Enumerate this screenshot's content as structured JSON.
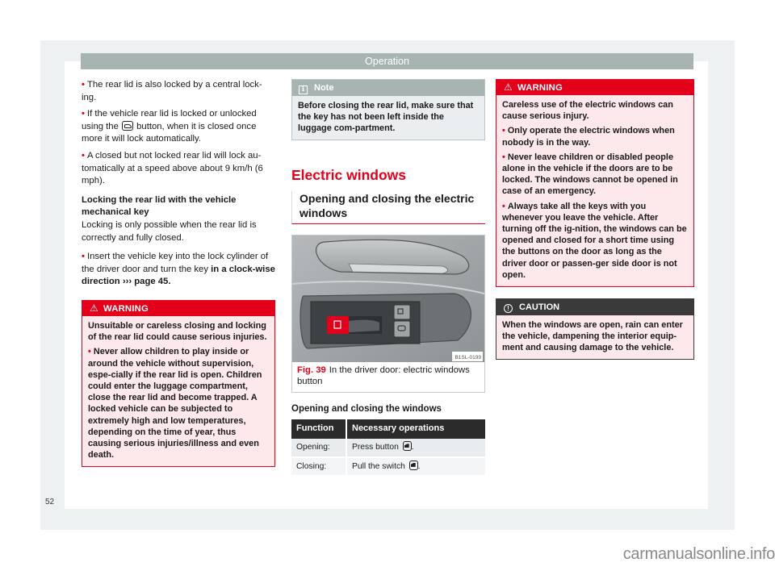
{
  "header": {
    "section": "Operation"
  },
  "page_number": "52",
  "watermark": "carmanualsonline.info",
  "column1": {
    "bullets": [
      "The rear lid is also locked by a central lock-ing.",
      {
        "before": "If the vehicle rear lid is locked or unlocked using the",
        "icon": "rear-lid-key-icon",
        "after": "button, when it is closed once more it will lock automatically."
      },
      "A closed but not locked rear lid will lock au-tomatically at a speed above about 9 km/h (6 mph)."
    ],
    "b1": "The rear lid is also locked by a central lock-ing.",
    "b2_before": "If the vehicle rear lid is locked or unlocked using the",
    "b2_after": "button, when it is closed once more it will lock automatically.",
    "b3": "A closed but not locked rear lid will lock au-tomatically at a speed above about 9 km/h (6 mph).",
    "subheading": "Locking the rear lid with the vehicle mechanical key",
    "paragraph": "Locking is only possible when the rear lid is correctly and fully closed.",
    "b4_before": "Insert the vehicle key into the lock cylinder of the driver door and turn the key",
    "b4_bold": "in a clock-wise direction",
    "b4_link": "››› page 45",
    "b4_end": ".",
    "warning": {
      "title": "WARNING",
      "intro": "Unsuitable or careless closing and locking of the rear lid could cause serious injuries.",
      "bullet": "Never allow children to play inside or around the vehicle without supervision, espe-cially if the rear lid is open. Children could enter the luggage compartment, close the rear lid and become trapped. A locked vehicle can be subjected to extremely high and low temperatures, depending on the time of year, thus causing serious injuries/illness and even death."
    }
  },
  "column2": {
    "note": {
      "title": "Note",
      "body": "Before closing the rear lid, make sure that the key has not been left inside the luggage com-partment."
    },
    "section_title": "Electric windows",
    "sub_title": "Opening and closing the electric windows",
    "figure": {
      "code": "B1SL-0199",
      "label": "Fig. 39",
      "caption": "In the driver door: electric windows button"
    },
    "table": {
      "title": "Opening and closing the windows",
      "headers": [
        "Function",
        "Necessary operations"
      ],
      "rows": [
        {
          "function": "Opening:",
          "operation": "Press button",
          "icon": "window-button-icon"
        },
        {
          "function": "Closing:",
          "operation": "Pull the switch",
          "icon": "window-button-icon"
        }
      ]
    }
  },
  "column3": {
    "warning": {
      "title": "WARNING",
      "intro": "Careless use of the electric windows can cause serious injury.",
      "bullets": [
        "Only operate the electric windows when nobody is in the way.",
        "Never leave children or disabled people alone in the vehicle if the doors are to be locked. The windows cannot be opened in case of an emergency.",
        "Always take all the keys with you whenever you leave the vehicle. After turning off the ig-nition, the windows can be opened and closed for a short time using the buttons on the door as long as the driver door or passen-ger side door is not open."
      ]
    },
    "caution": {
      "title": "CAUTION",
      "body": "When the windows are open, rain can enter the vehicle, dampening the interior equip-ment and causing damage to the vehicle."
    }
  },
  "colors": {
    "accent_red": "#e2001a",
    "header_grey": "#a7b4b2",
    "caution_dark": "#3a3a3a",
    "warning_bg": "#fde8ec",
    "note_bg": "#ebeef0"
  }
}
